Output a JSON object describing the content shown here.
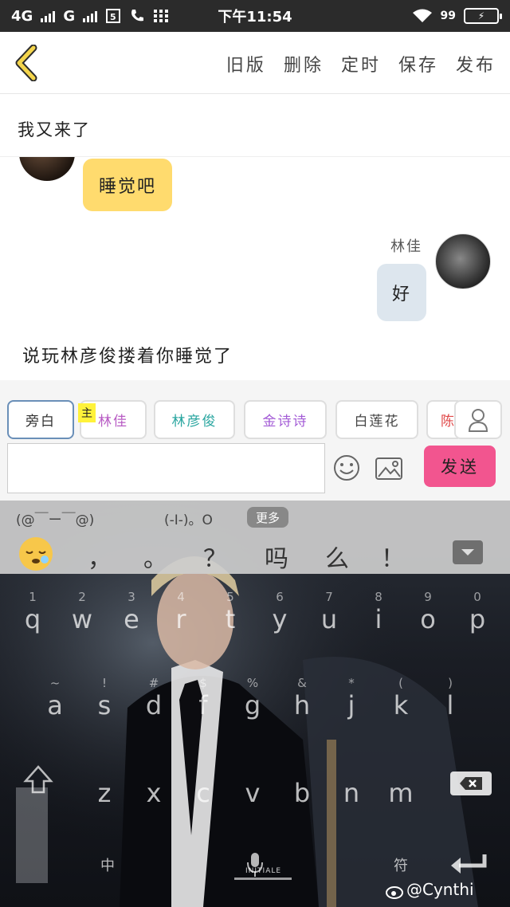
{
  "status_bar": {
    "network1": "4G",
    "network2": "G",
    "time": "下午11:54",
    "battery_percent": "99"
  },
  "header": {
    "actions": [
      "旧版",
      "删除",
      "定时",
      "保存",
      "发布"
    ]
  },
  "story": {
    "title": "我又来了"
  },
  "chat": {
    "left_bubble": "睡觉吧",
    "speaker_name": "林佳",
    "right_bubble": "好",
    "narration": "说玩林彦俊搂着你睡觉了"
  },
  "roles": {
    "main_tag": "主",
    "chips": [
      {
        "label": "旁白",
        "color": "#333333"
      },
      {
        "label": "林佳",
        "color": "#b85cc4"
      },
      {
        "label": "林彦俊",
        "color": "#2aa6a0"
      },
      {
        "label": "金诗诗",
        "color": "#a35bd6"
      },
      {
        "label": "白莲花",
        "color": "#444444"
      },
      {
        "label": "陈",
        "color": "#e04848"
      }
    ]
  },
  "composer": {
    "text": "",
    "send_label": "发送"
  },
  "keyboard": {
    "kaomoji": [
      "(@￣ー￣@)",
      "(-I-)。O"
    ],
    "more_label": "更多",
    "punctuation": [
      "，",
      "。",
      "？",
      "吗",
      "么",
      "！"
    ],
    "row1": [
      {
        "key": "q",
        "hint": "1"
      },
      {
        "key": "w",
        "hint": "2"
      },
      {
        "key": "e",
        "hint": "3"
      },
      {
        "key": "r",
        "hint": "4"
      },
      {
        "key": "t",
        "hint": "5"
      },
      {
        "key": "y",
        "hint": "6"
      },
      {
        "key": "u",
        "hint": "7"
      },
      {
        "key": "i",
        "hint": "8"
      },
      {
        "key": "o",
        "hint": "9"
      },
      {
        "key": "p",
        "hint": "0"
      }
    ],
    "row2": [
      {
        "key": "a",
        "hint": "~"
      },
      {
        "key": "s",
        "hint": "!"
      },
      {
        "key": "d",
        "hint": "#"
      },
      {
        "key": "f",
        "hint": "$"
      },
      {
        "key": "g",
        "hint": "%"
      },
      {
        "key": "h",
        "hint": "&"
      },
      {
        "key": "j",
        "hint": "*"
      },
      {
        "key": "k",
        "hint": "("
      },
      {
        "key": "l",
        "hint": ")"
      }
    ],
    "row3": [
      {
        "key": "z",
        "hint": ""
      },
      {
        "key": "x",
        "hint": ""
      },
      {
        "key": "c",
        "hint": ""
      },
      {
        "key": "v",
        "hint": ""
      },
      {
        "key": "b",
        "hint": ""
      },
      {
        "key": "n",
        "hint": ""
      },
      {
        "key": "m",
        "hint": ""
      }
    ],
    "lang_label": "中",
    "symbol_label": "符",
    "space_label": "INITIALE",
    "watermark": "@Cynthi"
  }
}
